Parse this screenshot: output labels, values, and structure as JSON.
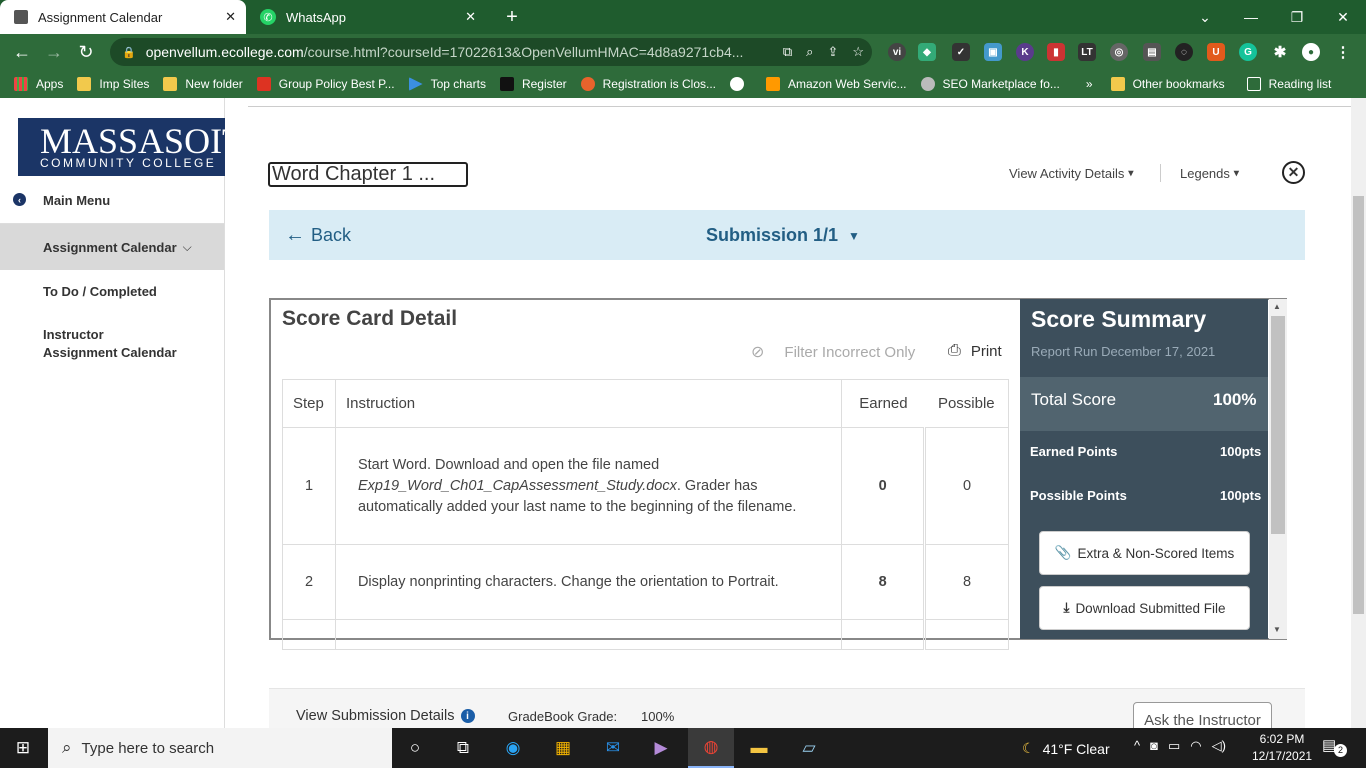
{
  "browser": {
    "tabs": [
      {
        "title": "Assignment Calendar"
      },
      {
        "title": "WhatsApp"
      }
    ],
    "url_host": "openvellum.ecollege.com",
    "url_path": "/course.html?courseId=17022613&OpenVellumHMAC=4d8a9271cb4...",
    "bookmarks": [
      "Apps",
      "Imp Sites",
      "New folder",
      "Group Policy Best P...",
      "Top charts",
      "Register",
      "Registration is Clos...",
      "Amazon Web Servic...",
      "SEO Marketplace fo...",
      "Other bookmarks",
      "Reading list"
    ],
    "bookmarks_more": "»"
  },
  "sidebar": {
    "logo_line1": "MASSASOIT",
    "logo_line2": "COMMUNITY COLLEGE",
    "items": [
      "Main Menu",
      "Assignment Calendar",
      "To Do / Completed",
      "Instructor",
      "Assignment Calendar"
    ]
  },
  "activity": {
    "name": "Word Chapter 1 ...",
    "view_details": "View Activity Details",
    "legends": "Legends",
    "back": "Back",
    "submission": "Submission 1/1"
  },
  "scorecard": {
    "title": "Score Card Detail",
    "filter": "Filter Incorrect Only",
    "print": "Print",
    "headers": [
      "Step",
      "Instruction",
      "Earned",
      "Possible"
    ],
    "rows": [
      {
        "step": "1",
        "pre": "Start Word. Download and open the file named ",
        "em": "Exp19_Word_Ch01_CapAssessment_Study.docx",
        "post": ". Grader has automatically added your last name to the beginning of the filename.",
        "earned": "0",
        "possible": "0"
      },
      {
        "step": "2",
        "pre": "Display nonprinting characters. Change the orientation to Portrait.",
        "em": "",
        "post": "",
        "earned": "8",
        "possible": "8"
      }
    ]
  },
  "summary": {
    "title": "Score Summary",
    "report": "Report Run December 17, 2021",
    "total_label": "Total Score",
    "total_value": "100%",
    "earned_label": "Earned Points",
    "earned_value": "100pts",
    "possible_label": "Possible Points",
    "possible_value": "100pts",
    "extra_btn": "Extra & Non-Scored Items",
    "download_btn": "Download Submitted File"
  },
  "bottom": {
    "view_submission": "View Submission Details",
    "gradebook_label": "GradeBook Grade:",
    "gradebook_value": "100%",
    "ask": "Ask the Instructor"
  },
  "taskbar": {
    "search_placeholder": "Type here to search",
    "weather": "41°F  Clear",
    "time": "6:02 PM",
    "date": "12/17/2021",
    "notifications": "2"
  }
}
